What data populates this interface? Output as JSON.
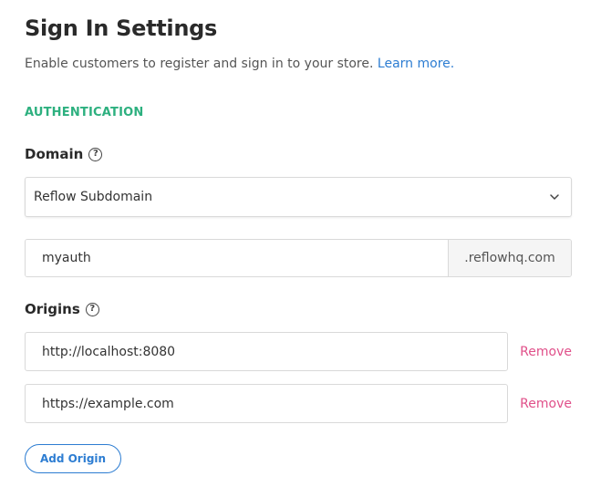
{
  "header": {
    "title": "Sign In Settings",
    "subtitle": "Enable customers to register and sign in to your store.",
    "learn_more": "Learn more"
  },
  "section": {
    "heading": "AUTHENTICATION"
  },
  "domain": {
    "label": "Domain",
    "selected": "Reflow Subdomain",
    "subdomain_value": "myauth",
    "suffix": ".reflowhq.com"
  },
  "origins": {
    "label": "Origins",
    "items": [
      {
        "value": "http://localhost:8080",
        "remove_label": "Remove"
      },
      {
        "value": "https://example.com",
        "remove_label": "Remove"
      }
    ],
    "add_label": "Add Origin"
  },
  "colors": {
    "accent_green": "#2db07f",
    "link_blue": "#2d7dd2",
    "remove_pink": "#e0508a"
  },
  "icons": {
    "help": "question-circle-icon",
    "dropdown": "chevron-down-icon"
  }
}
